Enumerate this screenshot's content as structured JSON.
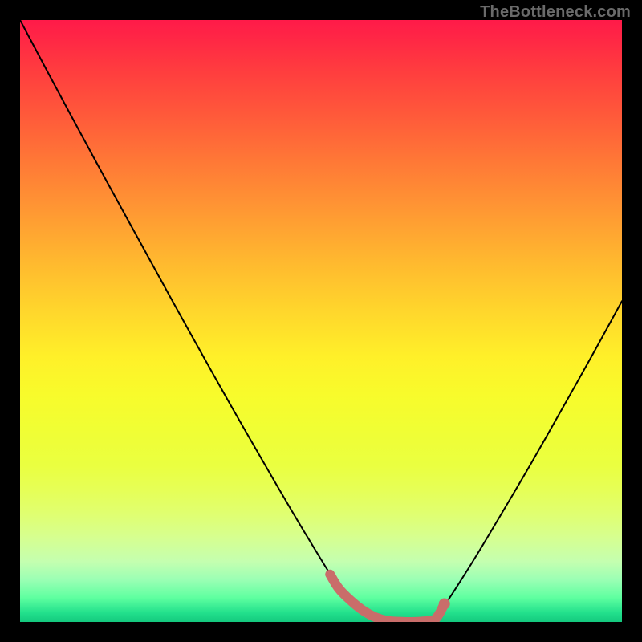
{
  "watermark": "TheBottleneck.com",
  "chart_data": {
    "type": "line",
    "title": "",
    "xlabel": "",
    "ylabel": "",
    "xlim": [
      0,
      100
    ],
    "ylim": [
      0,
      100
    ],
    "series": [
      {
        "name": "curve",
        "x": [
          0,
          5,
          10,
          15,
          20,
          25,
          30,
          35,
          40,
          45,
          50,
          52,
          55,
          58,
          62,
          65,
          68,
          70,
          75,
          80,
          85,
          90,
          95,
          100
        ],
        "y": [
          100,
          90.6,
          81.3,
          72.1,
          63.0,
          53.9,
          44.9,
          36.0,
          27.3,
          18.7,
          10.4,
          7.3,
          3.5,
          1.2,
          0.1,
          0.0,
          0.1,
          2.0,
          9.7,
          18.0,
          26.5,
          35.3,
          44.2,
          53.3
        ]
      }
    ],
    "highlight": {
      "color": "#c96d6a",
      "x": [
        51.5,
        53,
        55,
        57,
        59,
        61,
        63,
        65,
        67,
        69,
        70.5
      ],
      "y": [
        7.9,
        5.5,
        3.5,
        1.9,
        0.8,
        0.2,
        0.05,
        0.0,
        0.1,
        0.5,
        3.0
      ]
    }
  },
  "colors": {
    "curve": "#000000",
    "highlight": "#c96d6a",
    "background_top": "#ff1a49",
    "background_bottom": "#14c87e"
  }
}
